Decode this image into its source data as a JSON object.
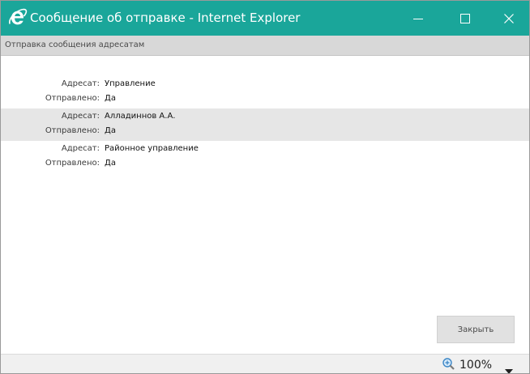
{
  "window": {
    "title": "Сообщение об отправке - Internet Explorer",
    "accent_color": "#1aa69a",
    "icon": "internet-explorer-icon"
  },
  "header": {
    "text": "Отправка сообщения адресатам"
  },
  "recipients": [
    {
      "recipient_label": "Адресат:",
      "recipient": "Управление",
      "sent_label": "Отправлено:",
      "sent": "Да"
    },
    {
      "recipient_label": "Адресат:",
      "recipient": "Алладиннов А.А.",
      "sent_label": "Отправлено:",
      "sent": "Да"
    },
    {
      "recipient_label": "Адресат:",
      "recipient": "Районное управление",
      "sent_label": "Отправлено:",
      "sent": "Да"
    }
  ],
  "actions": {
    "close_label": "Закрыть"
  },
  "statusbar": {
    "zoom": "100%"
  }
}
